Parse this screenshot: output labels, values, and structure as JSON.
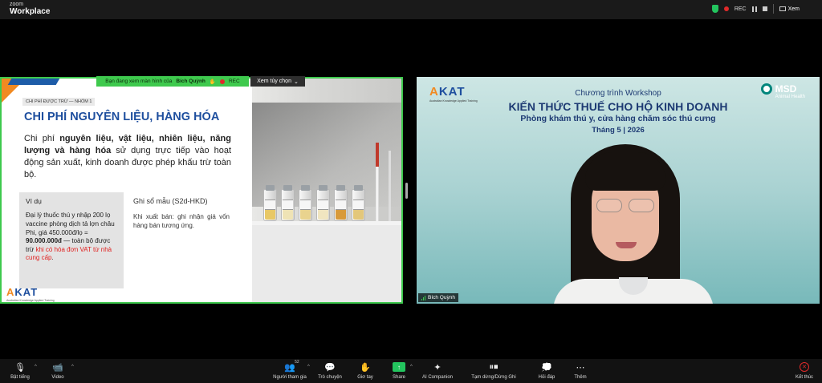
{
  "app": {
    "brand_small": "zoom",
    "brand_name": "Workplace"
  },
  "topbar": {
    "rec_label": "REC",
    "view_label": "Xem"
  },
  "share": {
    "banner_prefix": "Bạn đang xem màn hình của",
    "banner_user": "Bích Quỳnh",
    "banner_rec": "REC",
    "view_options": "Xem tùy chọn"
  },
  "slide": {
    "tag": "CHI PHÍ ĐƯỢC TRỪ — NHÓM 1",
    "title": "CHI PHÍ NGUYÊN LIỆU, HÀNG HÓA",
    "body_1": "Chi phí ",
    "body_bold_1": "nguyên liệu, vật liệu, nhiên liệu, năng lượng và hàng hóa",
    "body_2": " sử dụng trực tiếp vào hoạt động sản xuất, kinh doanh được phép khấu trừ toàn bộ.",
    "example_title": "Ví dụ",
    "example_1": "Đại lý thuốc thú y nhập 200 lọ vaccine phòng dịch tả lợn châu Phi, giá 450.000đ/lọ = ",
    "example_bold": "90.000.000đ",
    "example_2": " — toàn bộ được trừ ",
    "example_red": "khi có hóa đơn VAT từ nhà cung cấp",
    "example_end": ".",
    "ledger_title": "Ghi sổ mẫu (S2d-HKD)",
    "ledger_text": "Khi xuất bán: ghi nhận giá vốn hàng bán tương ứng.",
    "logo_a": "A",
    "logo_rest": "KAT",
    "logo_sub": "Australian Knowledge Applied Training"
  },
  "video": {
    "logo_a": "A",
    "logo_rest": "KAT",
    "logo_sub": "Australian Knowledge Applied Training",
    "msd_name": "MSD",
    "msd_sub": "Animal Health",
    "line1": "Chương trình Workshop",
    "line2": "KIẾN THỨC THUẾ CHO HỘ KINH DOANH",
    "line3": "Phòng khám thú y, cửa hàng chăm sóc thú cưng",
    "line4": "Tháng 5 | 2026",
    "participant_name": "Bích Quỳnh"
  },
  "toolbar": {
    "mute": "Bật tiếng",
    "video": "Video",
    "participants": "Người tham gia",
    "participants_count": "52",
    "chat": "Trò chuyện",
    "raise_hand": "Giơ tay",
    "share": "Share",
    "ai": "AI Companion",
    "pause_stop": "Tạm dừng/Dừng Ghi",
    "qa": "Hỏi đáp",
    "more": "Thêm",
    "end": "Kết thúc"
  },
  "colors": {
    "share_border": "#3ec94d",
    "brand_blue": "#1d4e9e",
    "brand_orange": "#f18a21",
    "alert_red": "#e02a2a"
  }
}
